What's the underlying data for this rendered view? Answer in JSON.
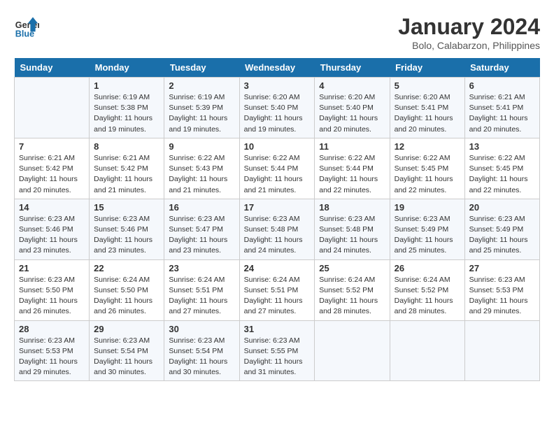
{
  "header": {
    "logo_line1": "General",
    "logo_line2": "Blue",
    "title": "January 2024",
    "subtitle": "Bolo, Calabarzon, Philippines"
  },
  "days_of_week": [
    "Sunday",
    "Monday",
    "Tuesday",
    "Wednesday",
    "Thursday",
    "Friday",
    "Saturday"
  ],
  "weeks": [
    [
      {
        "day": "",
        "info": ""
      },
      {
        "day": "1",
        "info": "Sunrise: 6:19 AM\nSunset: 5:38 PM\nDaylight: 11 hours\nand 19 minutes."
      },
      {
        "day": "2",
        "info": "Sunrise: 6:19 AM\nSunset: 5:39 PM\nDaylight: 11 hours\nand 19 minutes."
      },
      {
        "day": "3",
        "info": "Sunrise: 6:20 AM\nSunset: 5:40 PM\nDaylight: 11 hours\nand 19 minutes."
      },
      {
        "day": "4",
        "info": "Sunrise: 6:20 AM\nSunset: 5:40 PM\nDaylight: 11 hours\nand 20 minutes."
      },
      {
        "day": "5",
        "info": "Sunrise: 6:20 AM\nSunset: 5:41 PM\nDaylight: 11 hours\nand 20 minutes."
      },
      {
        "day": "6",
        "info": "Sunrise: 6:21 AM\nSunset: 5:41 PM\nDaylight: 11 hours\nand 20 minutes."
      }
    ],
    [
      {
        "day": "7",
        "info": "Sunrise: 6:21 AM\nSunset: 5:42 PM\nDaylight: 11 hours\nand 20 minutes."
      },
      {
        "day": "8",
        "info": "Sunrise: 6:21 AM\nSunset: 5:42 PM\nDaylight: 11 hours\nand 21 minutes."
      },
      {
        "day": "9",
        "info": "Sunrise: 6:22 AM\nSunset: 5:43 PM\nDaylight: 11 hours\nand 21 minutes."
      },
      {
        "day": "10",
        "info": "Sunrise: 6:22 AM\nSunset: 5:44 PM\nDaylight: 11 hours\nand 21 minutes."
      },
      {
        "day": "11",
        "info": "Sunrise: 6:22 AM\nSunset: 5:44 PM\nDaylight: 11 hours\nand 22 minutes."
      },
      {
        "day": "12",
        "info": "Sunrise: 6:22 AM\nSunset: 5:45 PM\nDaylight: 11 hours\nand 22 minutes."
      },
      {
        "day": "13",
        "info": "Sunrise: 6:22 AM\nSunset: 5:45 PM\nDaylight: 11 hours\nand 22 minutes."
      }
    ],
    [
      {
        "day": "14",
        "info": "Sunrise: 6:23 AM\nSunset: 5:46 PM\nDaylight: 11 hours\nand 23 minutes."
      },
      {
        "day": "15",
        "info": "Sunrise: 6:23 AM\nSunset: 5:46 PM\nDaylight: 11 hours\nand 23 minutes."
      },
      {
        "day": "16",
        "info": "Sunrise: 6:23 AM\nSunset: 5:47 PM\nDaylight: 11 hours\nand 23 minutes."
      },
      {
        "day": "17",
        "info": "Sunrise: 6:23 AM\nSunset: 5:48 PM\nDaylight: 11 hours\nand 24 minutes."
      },
      {
        "day": "18",
        "info": "Sunrise: 6:23 AM\nSunset: 5:48 PM\nDaylight: 11 hours\nand 24 minutes."
      },
      {
        "day": "19",
        "info": "Sunrise: 6:23 AM\nSunset: 5:49 PM\nDaylight: 11 hours\nand 25 minutes."
      },
      {
        "day": "20",
        "info": "Sunrise: 6:23 AM\nSunset: 5:49 PM\nDaylight: 11 hours\nand 25 minutes."
      }
    ],
    [
      {
        "day": "21",
        "info": "Sunrise: 6:23 AM\nSunset: 5:50 PM\nDaylight: 11 hours\nand 26 minutes."
      },
      {
        "day": "22",
        "info": "Sunrise: 6:24 AM\nSunset: 5:50 PM\nDaylight: 11 hours\nand 26 minutes."
      },
      {
        "day": "23",
        "info": "Sunrise: 6:24 AM\nSunset: 5:51 PM\nDaylight: 11 hours\nand 27 minutes."
      },
      {
        "day": "24",
        "info": "Sunrise: 6:24 AM\nSunset: 5:51 PM\nDaylight: 11 hours\nand 27 minutes."
      },
      {
        "day": "25",
        "info": "Sunrise: 6:24 AM\nSunset: 5:52 PM\nDaylight: 11 hours\nand 28 minutes."
      },
      {
        "day": "26",
        "info": "Sunrise: 6:24 AM\nSunset: 5:52 PM\nDaylight: 11 hours\nand 28 minutes."
      },
      {
        "day": "27",
        "info": "Sunrise: 6:23 AM\nSunset: 5:53 PM\nDaylight: 11 hours\nand 29 minutes."
      }
    ],
    [
      {
        "day": "28",
        "info": "Sunrise: 6:23 AM\nSunset: 5:53 PM\nDaylight: 11 hours\nand 29 minutes."
      },
      {
        "day": "29",
        "info": "Sunrise: 6:23 AM\nSunset: 5:54 PM\nDaylight: 11 hours\nand 30 minutes."
      },
      {
        "day": "30",
        "info": "Sunrise: 6:23 AM\nSunset: 5:54 PM\nDaylight: 11 hours\nand 30 minutes."
      },
      {
        "day": "31",
        "info": "Sunrise: 6:23 AM\nSunset: 5:55 PM\nDaylight: 11 hours\nand 31 minutes."
      },
      {
        "day": "",
        "info": ""
      },
      {
        "day": "",
        "info": ""
      },
      {
        "day": "",
        "info": ""
      }
    ]
  ]
}
